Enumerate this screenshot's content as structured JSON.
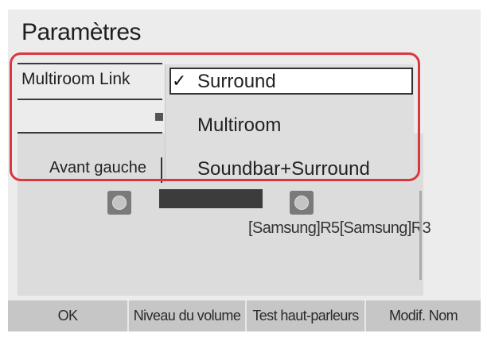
{
  "title": "Paramètres",
  "row": {
    "label": "Multiroom Link"
  },
  "dropdown": {
    "options": [
      {
        "label": "Surround",
        "selected": true
      },
      {
        "label": "Multiroom",
        "selected": false
      },
      {
        "label": "Soundbar+Surround",
        "selected": false
      }
    ],
    "check_mark": "✓"
  },
  "speakers": {
    "front_left_label": "Avant gauche",
    "names_label": "[Samsung]R5[Samsung]R3"
  },
  "bottom_bar": {
    "ok_label": "OK",
    "volume_label": "Niveau du volume",
    "test_label": "Test haut-parleurs",
    "rename_label": "Modif. Nom"
  },
  "colors": {
    "highlight": "#d9383f",
    "button_bg": "#c6c6c6",
    "panel_bg": "#ececec"
  }
}
